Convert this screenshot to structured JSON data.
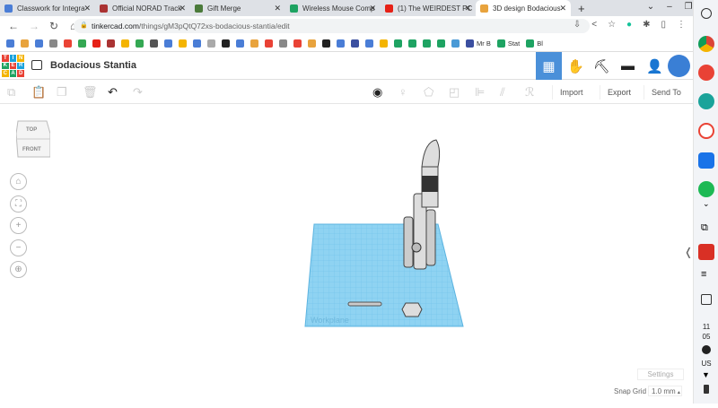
{
  "browser": {
    "tabs": [
      {
        "title": "Classwork for Integra",
        "color": "#4a7dd6"
      },
      {
        "title": "Official NORAD Track",
        "color": "#a33"
      },
      {
        "title": "Gift Merge",
        "color": "#4a7a3a"
      },
      {
        "title": "Wireless Mouse Comp",
        "color": "#1ea362"
      },
      {
        "title": "(1) The WEIRDEST PC",
        "color": "#e62117"
      },
      {
        "title": "3D design Bodacious",
        "color": "#e8a33d"
      }
    ],
    "url_host": "tinkercad.com",
    "url_path": "/things/gM3pQtQ72xs-bodacious-stantia/edit",
    "bookmarks": [
      {
        "label": "Mr B",
        "color": "#3b4fa0"
      },
      {
        "label": "Stat",
        "color": "#1ea362"
      },
      {
        "label": "Bl",
        "color": "#1ea362"
      }
    ]
  },
  "app": {
    "logo_letters": [
      "T",
      "I",
      "N",
      "K",
      "E",
      "R",
      "C",
      "A",
      "D"
    ],
    "title": "Bodacious Stantia",
    "toolbar": {
      "import": "Import",
      "export": "Export",
      "send_to": "Send To"
    },
    "viewcube": {
      "top": "TOP",
      "front": "FRONT"
    },
    "workplane_label": "Workplane",
    "settings": "Settings",
    "snap_grid_label": "Snap Grid",
    "snap_grid_value": "1.0 mm"
  },
  "shelf": {
    "time_h": "11",
    "time_m": "05",
    "locale": "US"
  },
  "colors": {
    "accent": "#4a90d9",
    "workplane": "#8fd3f2"
  }
}
